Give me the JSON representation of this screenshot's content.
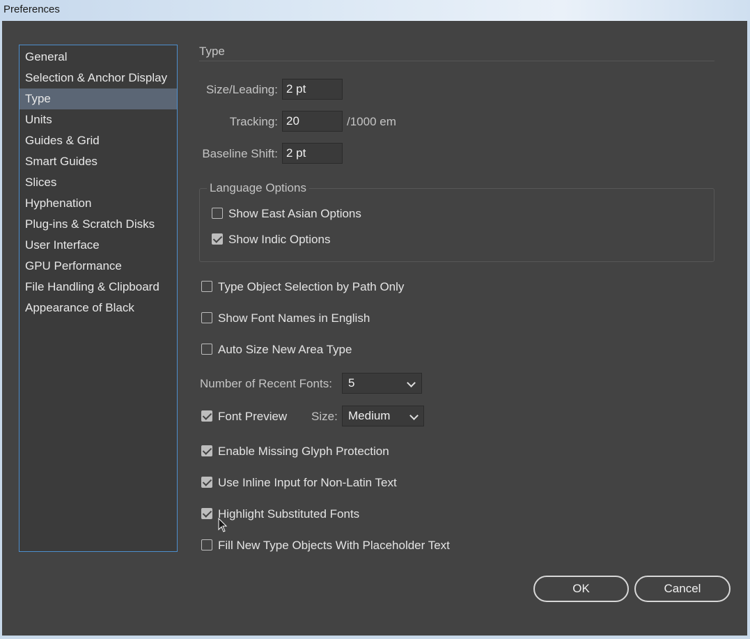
{
  "window": {
    "title": "Preferences"
  },
  "sidebar": {
    "items": [
      {
        "label": "General"
      },
      {
        "label": "Selection & Anchor Display"
      },
      {
        "label": "Type",
        "selected": true
      },
      {
        "label": "Units"
      },
      {
        "label": "Guides & Grid"
      },
      {
        "label": "Smart Guides"
      },
      {
        "label": "Slices"
      },
      {
        "label": "Hyphenation"
      },
      {
        "label": "Plug-ins & Scratch Disks"
      },
      {
        "label": "User Interface"
      },
      {
        "label": "GPU Performance"
      },
      {
        "label": "File Handling & Clipboard"
      },
      {
        "label": "Appearance of Black"
      }
    ]
  },
  "type_panel": {
    "title": "Type",
    "size_leading": {
      "label": "Size/Leading:",
      "value": "2 pt"
    },
    "tracking": {
      "label": "Tracking:",
      "value": "20",
      "unit": "/1000 em"
    },
    "baseline_shift": {
      "label": "Baseline Shift:",
      "value": "2 pt"
    },
    "language_options": {
      "legend": "Language Options",
      "east_asian": {
        "label": "Show East Asian Options",
        "checked": false
      },
      "indic": {
        "label": "Show Indic Options",
        "checked": true
      }
    },
    "type_object_selection": {
      "label": "Type Object Selection by Path Only",
      "checked": false
    },
    "font_names_english": {
      "label": "Show Font Names in English",
      "checked": false
    },
    "auto_size": {
      "label": "Auto Size New Area Type",
      "checked": false
    },
    "recent_fonts": {
      "label": "Number of Recent Fonts:",
      "value": "5"
    },
    "font_preview": {
      "label": "Font Preview",
      "checked": true,
      "size_label": "Size:",
      "size_value": "Medium"
    },
    "missing_glyph": {
      "label": "Enable Missing Glyph Protection",
      "checked": true
    },
    "inline_input": {
      "label": "Use Inline Input for Non-Latin Text",
      "checked": true
    },
    "highlight_substituted": {
      "label": "Highlight Substituted Fonts",
      "checked": true
    },
    "fill_placeholder": {
      "label": "Fill New Type Objects With Placeholder Text",
      "checked": false
    }
  },
  "buttons": {
    "ok": "OK",
    "cancel": "Cancel"
  },
  "colors": {
    "dialog_bg": "#434343",
    "sidebar_border": "#4d8fce",
    "selected_item": "#5b6675",
    "text": "#e4e4e4"
  }
}
